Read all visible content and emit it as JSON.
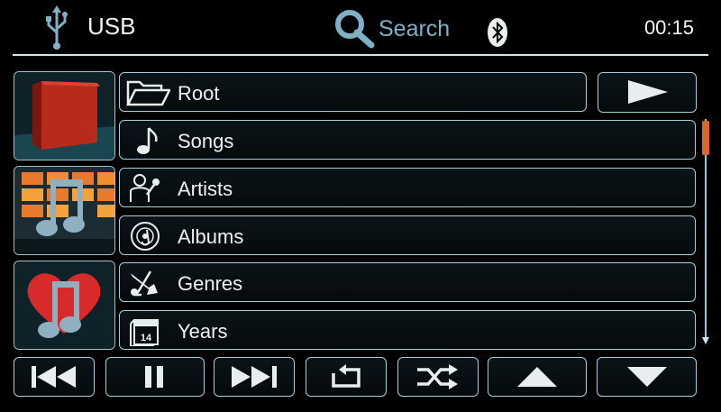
{
  "header": {
    "source_icon": "usb-icon",
    "source_label": "USB",
    "search_icon": "search-magnifier-icon",
    "search_label": "Search",
    "bluetooth_icon": "bluetooth-icon",
    "clock": "00:15"
  },
  "thumbnails": [
    {
      "icon": "folder-thumbnail"
    },
    {
      "icon": "music-grid-thumbnail"
    },
    {
      "icon": "heart-music-thumbnail"
    }
  ],
  "browse": {
    "items": [
      {
        "label": "Root",
        "icon": "folder-icon"
      },
      {
        "label": "Songs",
        "icon": "music-note-icon"
      },
      {
        "label": "Artists",
        "icon": "artist-mic-icon"
      },
      {
        "label": "Albums",
        "icon": "disc-icon"
      },
      {
        "label": "Genres",
        "icon": "instruments-icon"
      },
      {
        "label": "Years",
        "icon": "calendar-icon",
        "calendar_day": "14"
      }
    ],
    "play_icon": "play-icon"
  },
  "controls": [
    {
      "icon": "previous-track-icon"
    },
    {
      "icon": "pause-icon"
    },
    {
      "icon": "next-track-icon"
    },
    {
      "icon": "repeat-icon"
    },
    {
      "icon": "shuffle-icon"
    },
    {
      "icon": "arrow-up-icon"
    },
    {
      "icon": "arrow-down-icon"
    }
  ],
  "colors": {
    "background": "#000000",
    "border": "#a9ccd8",
    "accent_blue": "#7fb0c6",
    "scroll_thumb": "#d86a28"
  }
}
